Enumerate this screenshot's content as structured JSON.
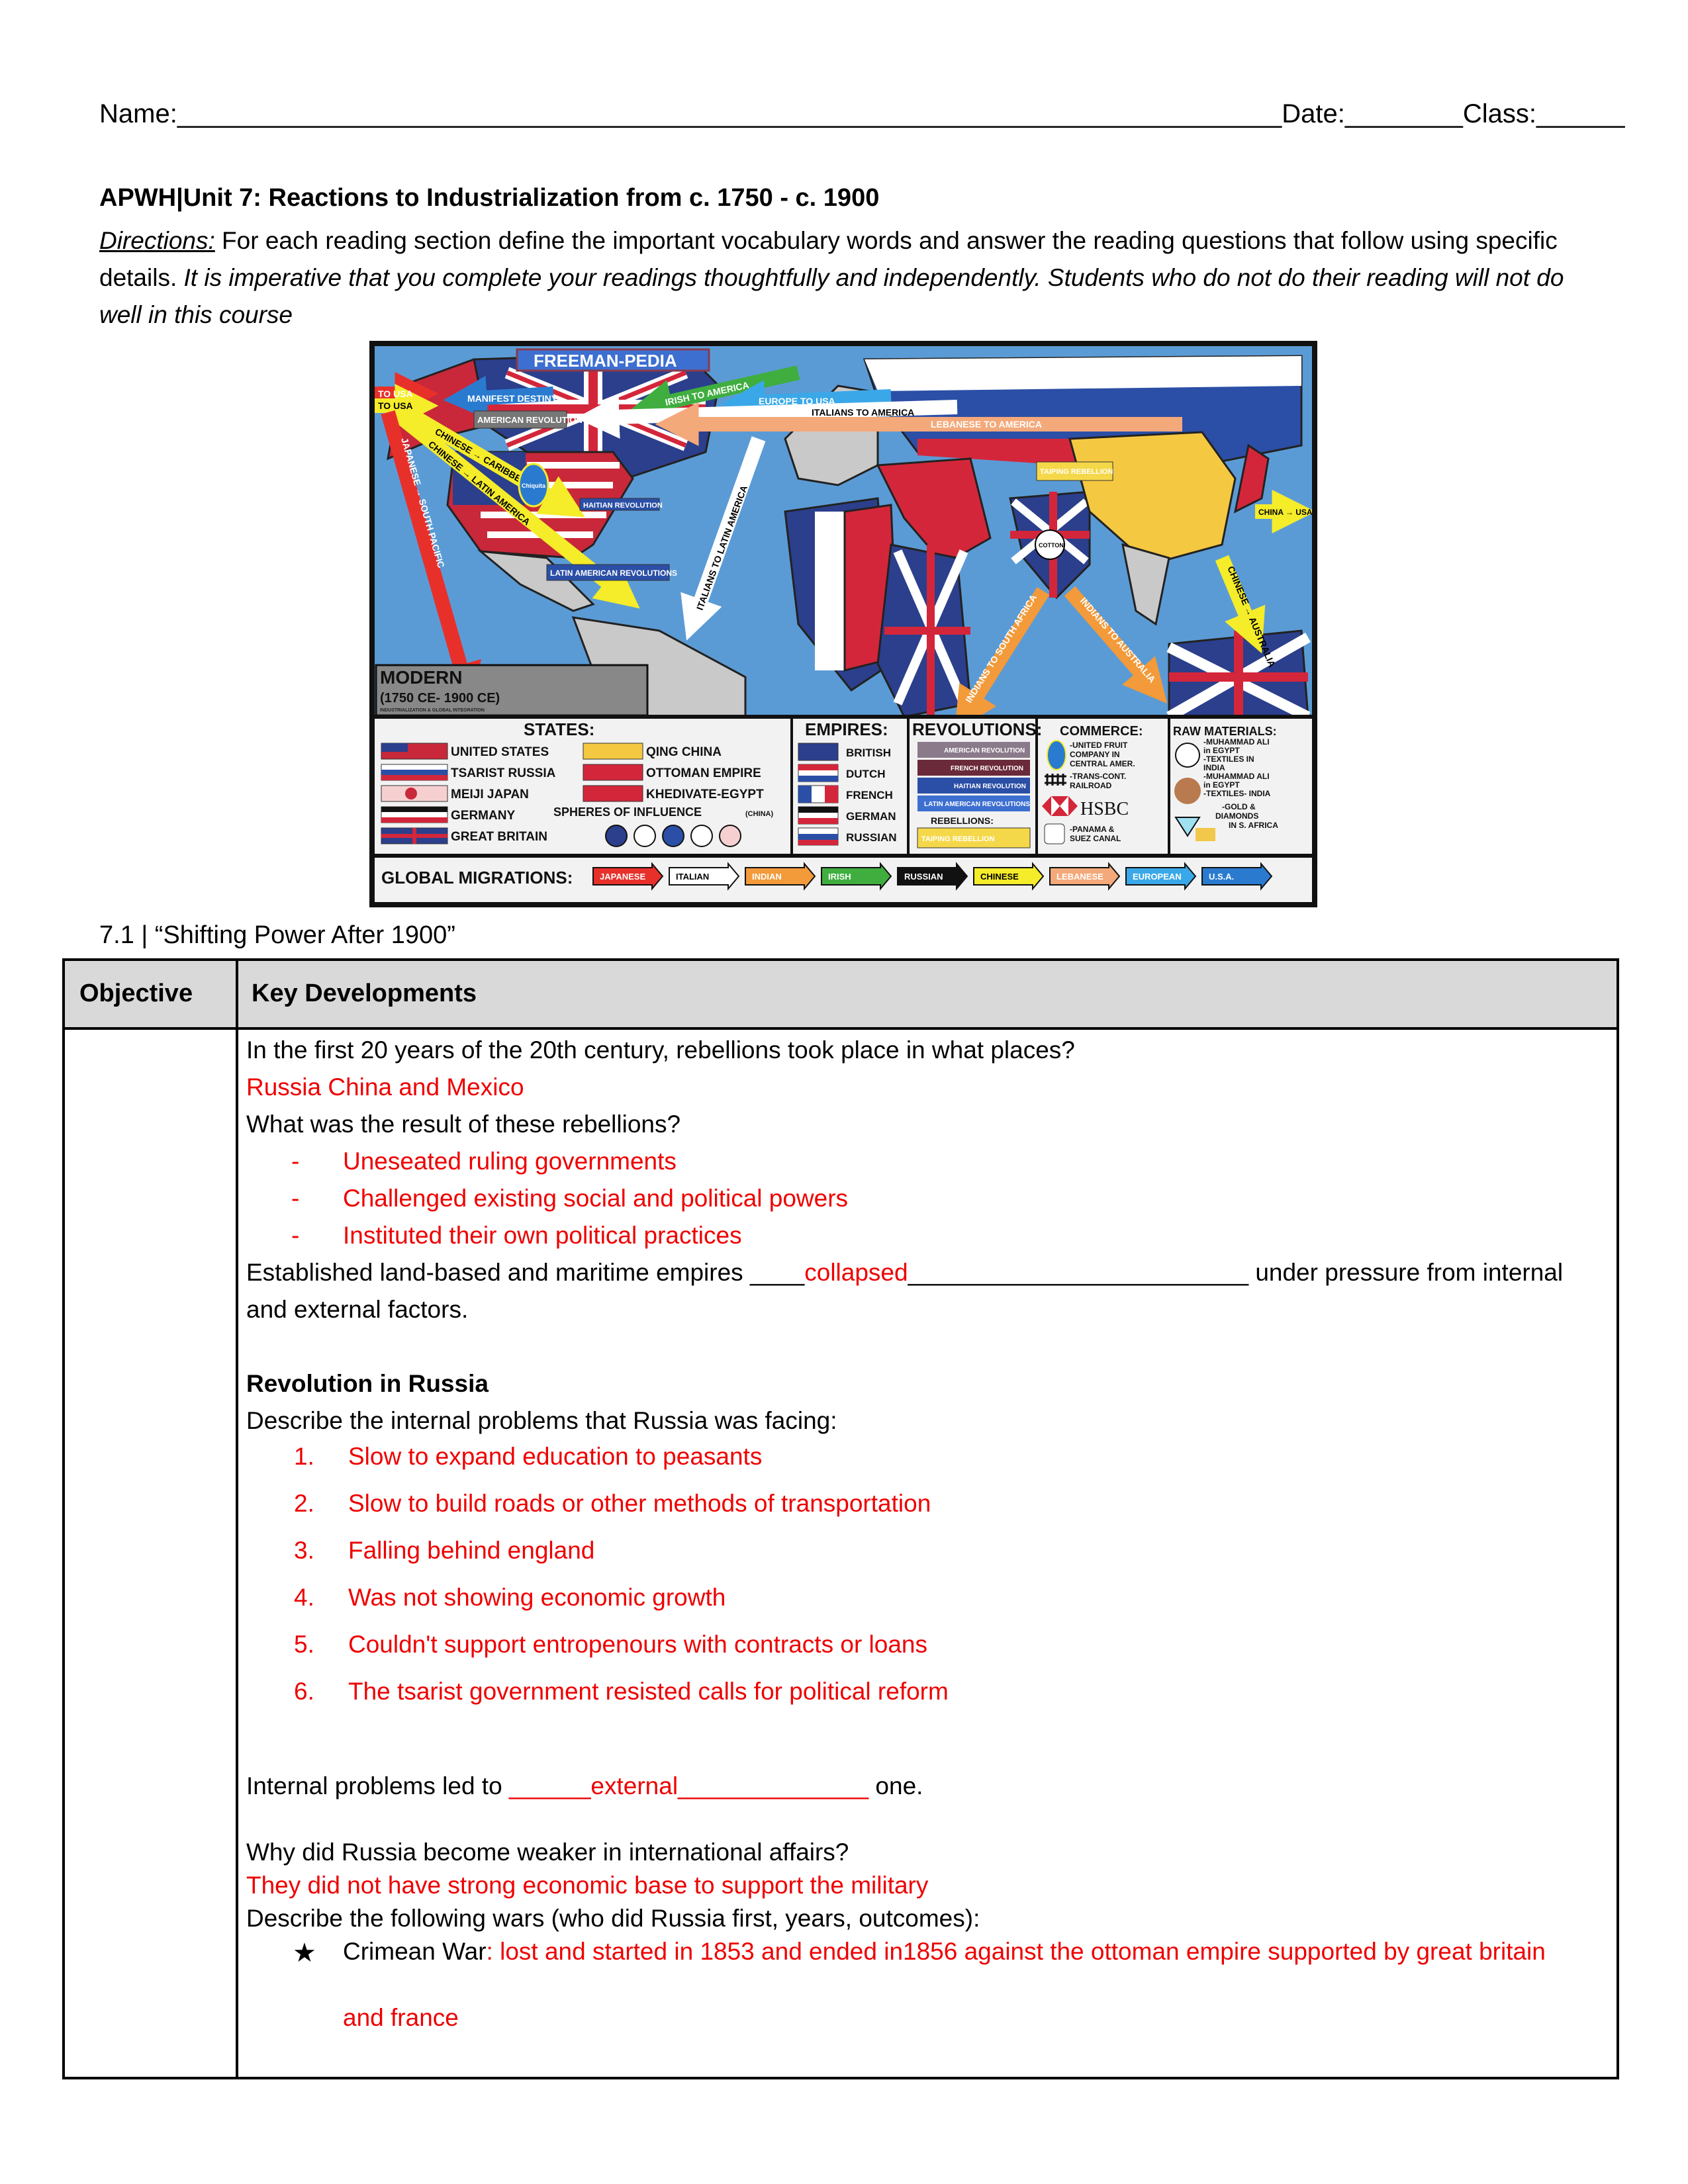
{
  "header": {
    "name_label": "Name:",
    "name_blank": "___________________________________________________________________________",
    "date_label": "Date:",
    "date_blank": "________",
    "class_label": "Class:",
    "class_blank": "______",
    "title": "APWH|Unit 7: Reactions to Industrialization from c. 1750 - c. 1900",
    "directions_label": "Directions:",
    "directions_text": " For each reading section define the important vocabulary words and answer the reading questions that follow using specific details. ",
    "directions_emphasis": "It is imperative that you complete your readings thoughtfully and independently. Students who do not do their reading will not do well in this course"
  },
  "map": {
    "banner": "FREEMAN-PEDIA",
    "era_title": "MODERN",
    "era_dates": "(1750 CE- 1900 CE)",
    "era_subtitle": "INDUSTRIALIZATION & GLOBAL INTEGRATION",
    "arrows": [
      {
        "label": "TO USA",
        "color": "#e8302b"
      },
      {
        "label": "TO USA",
        "color": "#f5ec2a"
      },
      {
        "label": "MANIFEST DESTINY",
        "color": "#2a7bd0"
      },
      {
        "label": "IRISH TO AMERICA",
        "color": "#3fae3f"
      },
      {
        "label": "EUROPE TO USA",
        "color": "#3aa8e8"
      },
      {
        "label": "ITALIANS TO AMERICA",
        "color": "#ffffff"
      },
      {
        "label": "LEBANESE TO AMERICA",
        "color": "#f4a97a"
      },
      {
        "label": "CHINESE → CARIBBEAN",
        "color": "#f5ec2a"
      },
      {
        "label": "CHINESE → LATIN AMERICA",
        "color": "#f5ec2a"
      },
      {
        "label": "JAPANESE → SOUTH PACIFIC",
        "color": "#e8302b"
      },
      {
        "label": "ITALIANS TO LATIN AMERICA",
        "color": "#ffffff"
      },
      {
        "label": "INDIANS TO SOUTH AFRICA",
        "color": "#f39a3a"
      },
      {
        "label": "INDIANS TO AUSTRALIA",
        "color": "#f39a3a"
      },
      {
        "label": "CHINESE → AUSTRALIA",
        "color": "#f5ec2a"
      },
      {
        "label": "CHINA → USA",
        "color": "#f5ec2a"
      }
    ],
    "badges": {
      "american_revolution": "AMERICAN REVOLUTION",
      "haitian_revolution": "HAITIAN REVOLUTION",
      "latin_american_revolutions": "LATIN AMERICAN REVOLUTIONS",
      "french_revolution": "FRENCH REVOLUTION",
      "taiping_rebellion": "TAIPING REBELLION",
      "cotton": "COTTON",
      "chiquita": "Chiquita"
    },
    "legend": {
      "states_title": "STATES:",
      "states": [
        "UNITED STATES",
        "TSARIST RUSSIA",
        "MEIJI JAPAN",
        "GERMANY",
        "GREAT BRITAIN"
      ],
      "states2": [
        "QING CHINA",
        "OTTOMAN EMPIRE",
        "KHEDIVATE-EGYPT"
      ],
      "spheres_title": "SPHERES OF INFLUENCE",
      "spheres_note": "(CHINA)",
      "empires_title": "EMPIRES:",
      "empires": [
        "BRITISH",
        "DUTCH",
        "FRENCH",
        "GERMAN",
        "RUSSIAN"
      ],
      "revolutions_title": "REVOLUTIONS:",
      "revolutions": [
        "AMERICAN REVOLUTION",
        "FRENCH REVOLUTION",
        "HAITIAN REVOLUTION",
        "LATIN AMERICAN REVOLUTIONS"
      ],
      "rebellions_title": "REBELLIONS:",
      "rebellions": [
        "TAIPING REBELLION"
      ],
      "commerce_title": "COMMERCE:",
      "commerce": [
        "-UNITED FRUIT",
        "COMPANY IN",
        "CENTRAL AMER.",
        "-TRANS-CONT.",
        "RAILROAD",
        "HSBC",
        "-PANAMA &",
        "SUEZ CANAL"
      ],
      "raw_title": "RAW MATERIALS:",
      "raw": [
        "-MUHAMMAD ALI",
        "in EGYPT",
        "-TEXTILES IN",
        "INDIA",
        "-MUHAMMAD ALI",
        "in EGYPT",
        "-TEXTILES- INDIA",
        "-GOLD &",
        "DIAMONDS",
        "IN S. AFRICA"
      ],
      "migrations_title": "GLOBAL MIGRATIONS:",
      "migrations": [
        {
          "label": "JAPANESE",
          "color": "#e8302b",
          "text": "#ffffff"
        },
        {
          "label": "ITALIAN",
          "color": "#ffffff",
          "text": "#000000"
        },
        {
          "label": "INDIAN",
          "color": "#f39a3a",
          "text": "#ffffff"
        },
        {
          "label": "IRISH",
          "color": "#3fae3f",
          "text": "#ffffff"
        },
        {
          "label": "RUSSIAN",
          "color": "#111111",
          "text": "#ffffff"
        },
        {
          "label": "CHINESE",
          "color": "#f5ec2a",
          "text": "#000000"
        },
        {
          "label": "LEBANESE",
          "color": "#f4a97a",
          "text": "#ffffff"
        },
        {
          "label": "EUROPEAN",
          "color": "#3aa8e8",
          "text": "#ffffff"
        },
        {
          "label": "U.S.A.",
          "color": "#2a7bd0",
          "text": "#ffffff"
        }
      ]
    }
  },
  "section": {
    "title": "7.1 | “Shifting Power After 1900”",
    "table": {
      "col_objective": "Objective",
      "col_key": "Key Developments"
    },
    "q1": "In the first 20 years of the 20th century, rebellions took place in what places?",
    "a1": "Russia China and Mexico",
    "q2": "What was the result of these rebellions?",
    "a2": [
      "Uneseated ruling governments",
      "Challenged existing social and political powers",
      "Instituted their own political practices"
    ],
    "fill1_pre": "Established land-based and maritime empires ____",
    "fill1_answer": "collapsed",
    "fill1_post_blank": "_________________________",
    "fill1_post": " under pressure from internal",
    "fill1_line2": "and external factors.",
    "subheading": "Revolution in Russia",
    "q3": "Describe the internal problems that Russia was facing:",
    "a3": [
      {
        "num": "1.",
        "text": "Slow to expand education to peasants"
      },
      {
        "num": "2.",
        "text": "Slow to build roads or other methods of transportation"
      },
      {
        "num": "3.",
        "text": "Falling behind england"
      },
      {
        "num": "4.",
        "text": "Was not showing economic growth"
      },
      {
        "num": "5.",
        "text": "Couldn't support entropenours with contracts or loans"
      },
      {
        "num": "6.",
        "text": "The tsarist government resisted calls for political reform"
      }
    ],
    "fill2_pre": "Internal problems led to ",
    "fill2_blank1": "______",
    "fill2_answer": "external",
    "fill2_blank2": "______________",
    "fill2_post": "  one.",
    "q4": "Why did Russia become weaker in international affairs?",
    "a4": "They did not have strong economic base to support the military",
    "q5": "Describe the following wars (who did Russia first, years, outcomes):",
    "war1_label": "Crimean War",
    "war1_answer": ": lost and started in 1853 and ended in1856 against the ottoman empire supported by great britain",
    "war1_answer_cont": "and france",
    "star_icon": "★"
  }
}
